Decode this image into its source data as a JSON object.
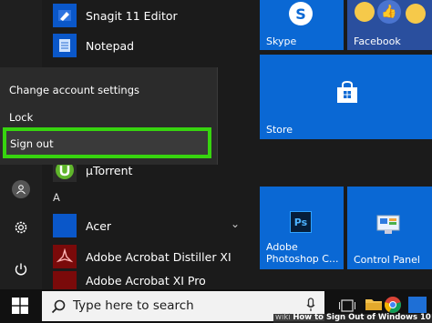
{
  "colors": {
    "accent": "#0a68d4",
    "signout_highlight": "#37d40f",
    "taskbar": "#111111"
  },
  "app_list": {
    "items": [
      {
        "label": "Snagit 11 Editor",
        "icon": "snagit-editor-icon"
      },
      {
        "label": "Notepad",
        "icon": "notepad-icon"
      },
      {
        "label": "µTorrent",
        "icon": "utorrent-icon"
      }
    ],
    "section_letter": "A",
    "a_items": [
      {
        "label": "Acer",
        "icon": "folder-icon"
      },
      {
        "label": "Adobe Acrobat Distiller XI",
        "icon": "acrobat-distiller-icon"
      },
      {
        "label": "Adobe Acrobat XI Pro",
        "icon": "acrobat-pro-icon"
      }
    ]
  },
  "account_menu": {
    "change_settings": "Change account settings",
    "lock": "Lock",
    "sign_out": "Sign out"
  },
  "tiles": {
    "skype": "Skype",
    "facebook": "Facebook",
    "store": "Store",
    "photoshop": "Adobe Photoshop C...",
    "photoshop_badge": "Ps",
    "control_panel": "Control Panel"
  },
  "taskbar": {
    "search_placeholder": "Type here to search"
  },
  "watermark": {
    "site": "wiki",
    "caption": "How to Sign Out of Windows 10"
  }
}
